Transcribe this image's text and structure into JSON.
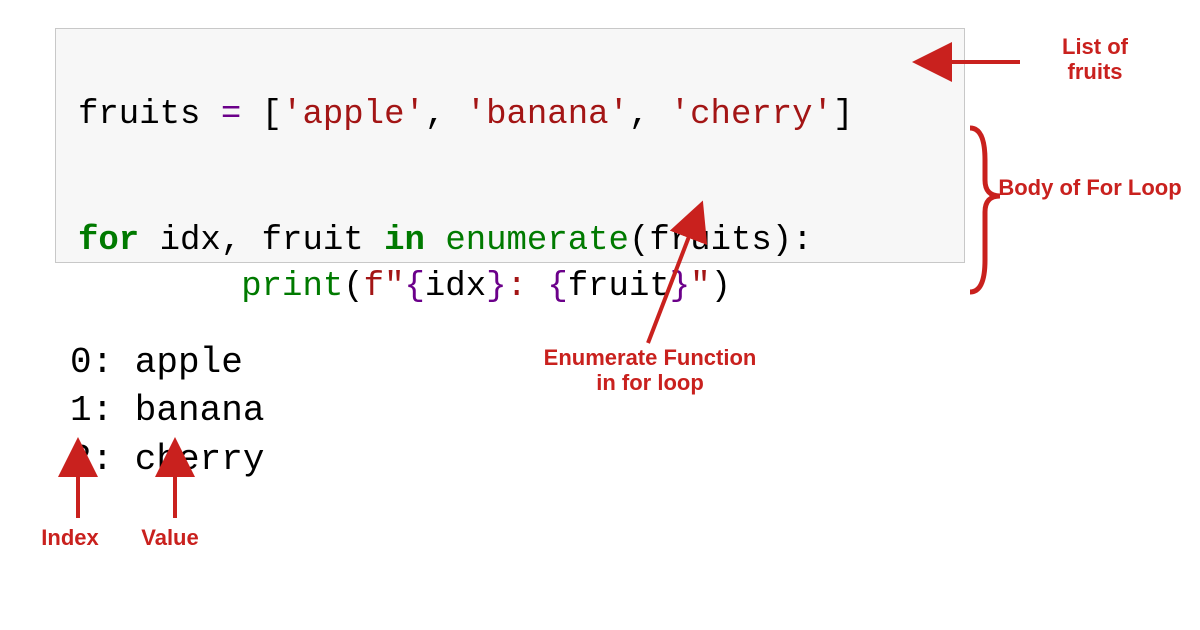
{
  "code": {
    "lang": "python",
    "line1": {
      "lhs": "fruits",
      "assign": " = ",
      "lb": "[",
      "s1": "'apple'",
      "c1": ", ",
      "s2": "'banana'",
      "c2": ", ",
      "s3": "'cherry'",
      "rb": "]"
    },
    "line2": {
      "for": "for",
      "sp1": " ",
      "idx": "idx",
      "comma": ",",
      "sp2": " ",
      "fruit": "fruit",
      "sp3": " ",
      "in": "in",
      "sp4": " ",
      "fn": "enumerate",
      "lp": "(",
      "arg": "fruits",
      "rp": ")",
      "colon": ":"
    },
    "line3": {
      "indent": "        ",
      "fn": "print",
      "lp": "(",
      "fpre": "f\"",
      "br1l": "{",
      "v1": "idx",
      "br1r": "}",
      "lit": ": ",
      "br2l": "{",
      "v2": "fruit",
      "br2r": "}",
      "fpost": "\"",
      "rp": ")"
    }
  },
  "output": {
    "lines": [
      "0: apple",
      "1: banana",
      "2: cherry"
    ]
  },
  "annotations": {
    "list_of_fruits": "List of\nfruits",
    "body_of_loop": "Body of For Loop",
    "enumerate_fn": "Enumerate Function\nin for loop",
    "index": "Index",
    "value": "Value"
  },
  "colors": {
    "annotation": "#c9211e",
    "code_bg": "#f7f7f7",
    "keyword": "#007a00",
    "string": "#a31515"
  }
}
